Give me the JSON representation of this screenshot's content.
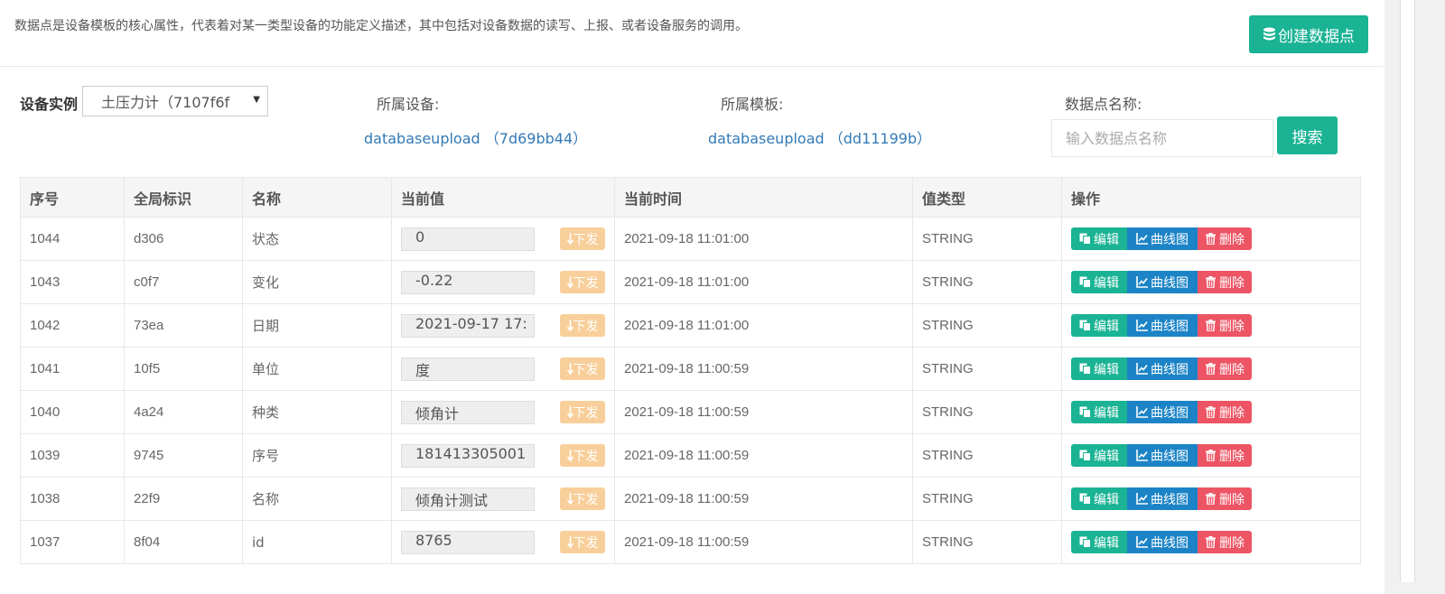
{
  "header": {
    "description": "数据点是设备模板的核心属性，代表着对某一类型设备的功能定义描述，其中包括对设备数据的读写、上报、或者设备服务的调用。",
    "create_label": "创建数据点"
  },
  "filters": {
    "instance_label": "设备实例",
    "instance_value": "土压力计（7107f6f",
    "device_label": "所属设备:",
    "device_link": "databaseupload （7d69bb44）",
    "template_label": "所属模板:",
    "template_link": "databaseupload （dd11199b）",
    "name_label": "数据点名称:",
    "name_placeholder": "输入数据点名称",
    "search_label": "搜索"
  },
  "table": {
    "headers": [
      "序号",
      "全局标识",
      "名称",
      "当前值",
      "当前时间",
      "值类型",
      "操作"
    ],
    "send_label": "下发",
    "edit_label": "编辑",
    "chart_label": "曲线图",
    "delete_label": "删除",
    "rows": [
      {
        "id": "1044",
        "key": "d306",
        "name": "状态",
        "value": "0",
        "time": "2021-09-18 11:01:00",
        "type": "STRING"
      },
      {
        "id": "1043",
        "key": "c0f7",
        "name": "变化",
        "value": "-0.22",
        "time": "2021-09-18 11:01:00",
        "type": "STRING"
      },
      {
        "id": "1042",
        "key": "73ea",
        "name": "日期",
        "value": "2021-09-17 17:",
        "time": "2021-09-18 11:01:00",
        "type": "STRING"
      },
      {
        "id": "1041",
        "key": "10f5",
        "name": "单位",
        "value": "度",
        "time": "2021-09-18 11:00:59",
        "type": "STRING"
      },
      {
        "id": "1040",
        "key": "4a24",
        "name": "种类",
        "value": "倾角计",
        "time": "2021-09-18 11:00:59",
        "type": "STRING"
      },
      {
        "id": "1039",
        "key": "9745",
        "name": "序号",
        "value": "181413305001",
        "time": "2021-09-18 11:00:59",
        "type": "STRING"
      },
      {
        "id": "1038",
        "key": "22f9",
        "name": "名称",
        "value": "倾角计测试",
        "time": "2021-09-18 11:00:59",
        "type": "STRING"
      },
      {
        "id": "1037",
        "key": "8f04",
        "name": "id",
        "value": "8765",
        "time": "2021-09-18 11:00:59",
        "type": "STRING"
      }
    ]
  },
  "colors": {
    "primary": "#1ab394",
    "info": "#1c84c6",
    "danger": "#ed5565",
    "warning_light": "#f8cf9a",
    "link": "#337ab7"
  }
}
